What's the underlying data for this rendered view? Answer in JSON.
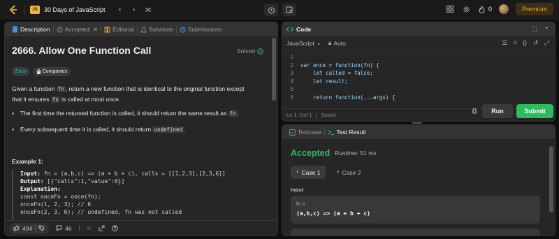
{
  "header": {
    "list_badge": "JS",
    "list_title": "30 Days of JavaScript",
    "streak_count": "0",
    "premium_label": "Premium"
  },
  "left": {
    "tabs": [
      "Description",
      "Accepted",
      "Editorial",
      "Solutions",
      "Submissions"
    ],
    "problem_title": "2666. Allow One Function Call",
    "solved_label": "Solved",
    "difficulty": "Easy",
    "companies_label": "Companies",
    "desc_p1_a": "Given a function ",
    "desc_p1_code": "fn",
    "desc_p1_b": ", return a new function that is identical to the original function except",
    "desc_p1_c": "that it ensures ",
    "desc_p1_code2": "fn",
    "desc_p1_d": " is called at most once.",
    "bullet1_a": "The first time the returned function is called, it should return the same result as ",
    "bullet1_code": "fn",
    "bullet1_b": ".",
    "bullet2_a": "Every subsequent time it is called, it should return ",
    "bullet2_code": "undefined",
    "bullet2_b": ".",
    "example_title": "Example 1:",
    "example": {
      "input_label": "Input:",
      "input_value": " fn = (a,b,c) => (a + b + c), calls = [[1,2,3],[2,3,6]]",
      "output_label": "Output:",
      "output_value": " [{\"calls\":1,\"value\":6}]",
      "explanation_label": "Explanation:",
      "lines": [
        "const onceFn = once(fn);",
        "onceFn(1, 2, 3); // 6",
        "onceFn(2, 3, 6); // undefined, fn was not called"
      ]
    },
    "likes": "494",
    "comments": "46"
  },
  "code": {
    "title": "Code",
    "language": "JavaScript",
    "mode": "Auto",
    "lines": [
      {
        "n": "1",
        "html": ""
      },
      {
        "n": "2",
        "html": "var once = function(fn) {"
      },
      {
        "n": "3",
        "html": "    let called = false;"
      },
      {
        "n": "4",
        "html": "    let result;"
      },
      {
        "n": "5",
        "html": ""
      },
      {
        "n": "6",
        "html": "    return function(...args) {"
      }
    ],
    "status": "Ln 1, Col 1",
    "saved": "Saved",
    "run_label": "Run",
    "submit_label": "Submit"
  },
  "result": {
    "tab_testcase": "Testcase",
    "tab_result": "Test Result",
    "status": "Accepted",
    "runtime": "Runtime: 51 ms",
    "cases": [
      "Case 1",
      "Case 2"
    ],
    "input_label": "Input",
    "param_name": "fn =",
    "param_value": "(a,b,c) => (a + b + c)"
  },
  "colors": {
    "accent_green": "#2cbb5d",
    "premium": "#f0a52e",
    "easy": "#1cbaba"
  }
}
